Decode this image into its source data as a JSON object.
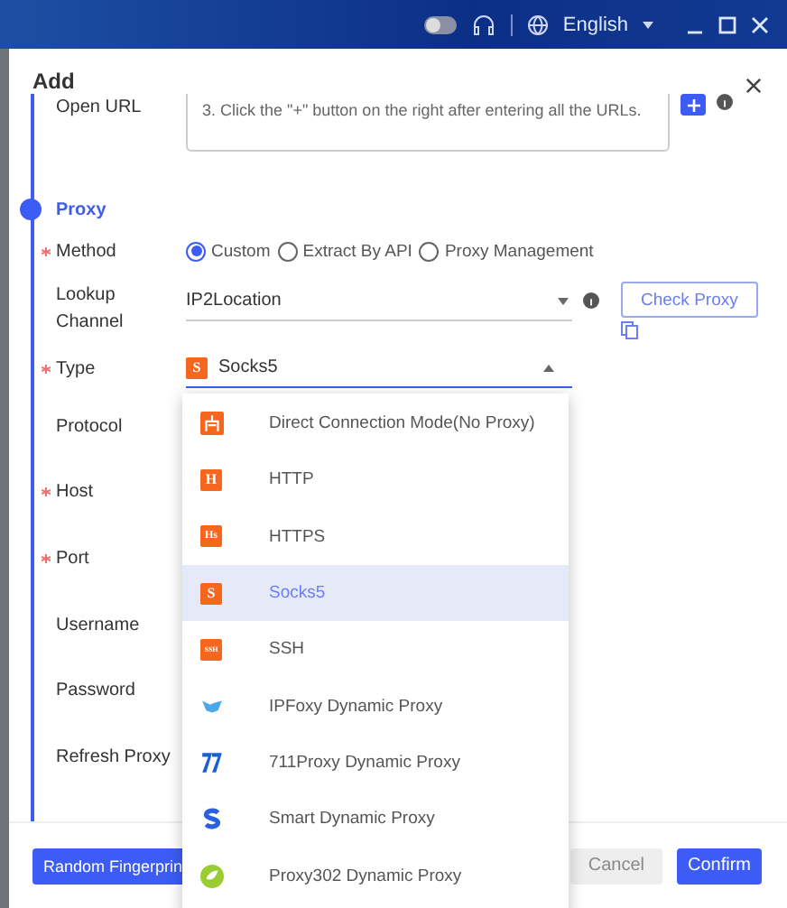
{
  "title_bar": {
    "toggle_on": false,
    "language": "English"
  },
  "dialog": {
    "title": "Add",
    "open_url": {
      "label": "Open URL",
      "placeholder": "3. Click the \"+\" button on the right after entering all the URLs."
    },
    "step": {
      "label": "Proxy",
      "active": true
    },
    "method": {
      "label": "Method",
      "required": true,
      "options": [
        {
          "label": "Custom",
          "selected": true
        },
        {
          "label": "Extract By API",
          "selected": false
        },
        {
          "label": "Proxy Management",
          "selected": false
        }
      ]
    },
    "lookup_channel": {
      "label": "Lookup Channel",
      "value": "IP2Location",
      "button": "Check Proxy"
    },
    "type": {
      "label": "Type",
      "required": true,
      "value": "Socks5",
      "badge": "S",
      "open": true
    },
    "fields": [
      {
        "label": "Protocol",
        "required": false
      },
      {
        "label": "Host",
        "required": true
      },
      {
        "label": "Port",
        "required": true
      },
      {
        "label": "Username",
        "required": false
      },
      {
        "label": "Password",
        "required": false
      },
      {
        "label": "Refresh Proxy",
        "required": false
      }
    ],
    "footer": {
      "left_button": "Random Fingerprin",
      "cancel": "Cancel",
      "confirm": "Confirm"
    }
  },
  "dropdown": [
    {
      "label": "Direct Connection Mode(No Proxy)",
      "kind": "direct",
      "selected": false
    },
    {
      "label": "HTTP",
      "kind": "badge",
      "badge": "H",
      "selected": false
    },
    {
      "label": "HTTPS",
      "kind": "badge",
      "badge": "Hs",
      "selected": false
    },
    {
      "label": "Socks5",
      "kind": "badge",
      "badge": "S",
      "selected": true
    },
    {
      "label": "SSH",
      "kind": "badge",
      "badge": "SSH",
      "selected": false
    },
    {
      "label": "IPFoxy Dynamic Proxy",
      "kind": "fox",
      "selected": false
    },
    {
      "label": "711Proxy Dynamic Proxy",
      "kind": "seven",
      "selected": false
    },
    {
      "label": "Smart Dynamic Proxy",
      "kind": "smart",
      "selected": false
    },
    {
      "label": "Proxy302 Dynamic Proxy",
      "kind": "leaf",
      "selected": false
    }
  ]
}
